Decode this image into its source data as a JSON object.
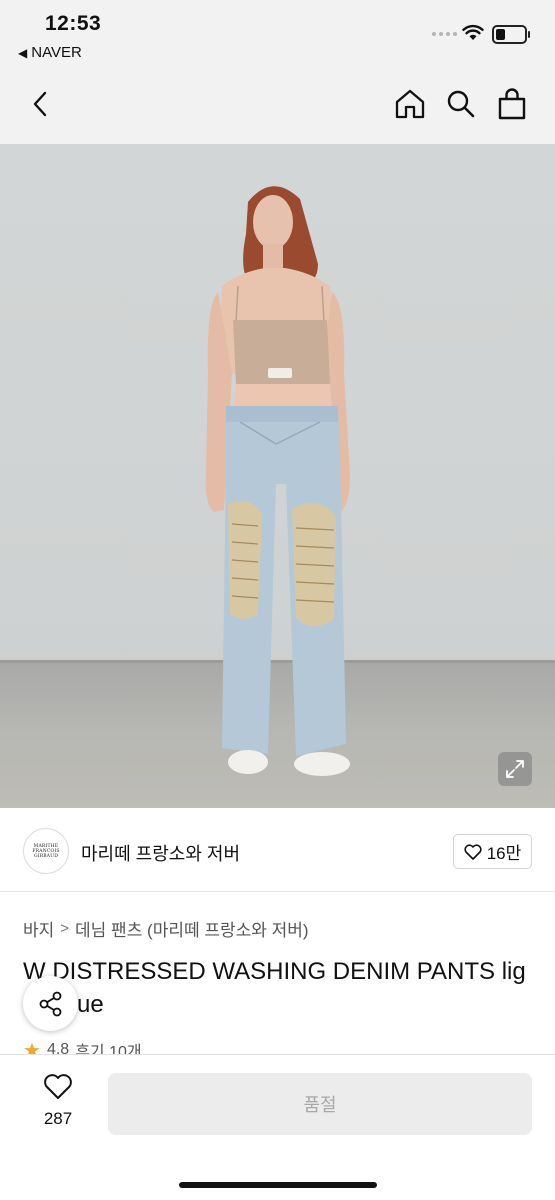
{
  "status_bar": {
    "time": "12:53",
    "back_app": "NAVER"
  },
  "nav": {
    "icons": [
      "back-icon",
      "home-icon",
      "search-icon",
      "shopping-bag-icon"
    ]
  },
  "brand": {
    "logo_lines": [
      "MARITHE",
      "FRANCOIS",
      "GIRBAUD"
    ],
    "name": "마리떼 프랑소와 저버",
    "follow_count": "16만"
  },
  "product": {
    "breadcrumb": [
      "바지",
      "데님 팬츠 (마리떼 프랑소와 저버)"
    ],
    "title_line1": "W DISTRESSED WASHING DENIM PANTS lig",
    "title_line2": "ue",
    "rating": "4.8",
    "reviews": "후기 10개"
  },
  "bottom": {
    "like_count": "287",
    "buy_label": "품절"
  },
  "colors": {
    "star": "#f5a623",
    "disabled_button": "#ececec"
  }
}
